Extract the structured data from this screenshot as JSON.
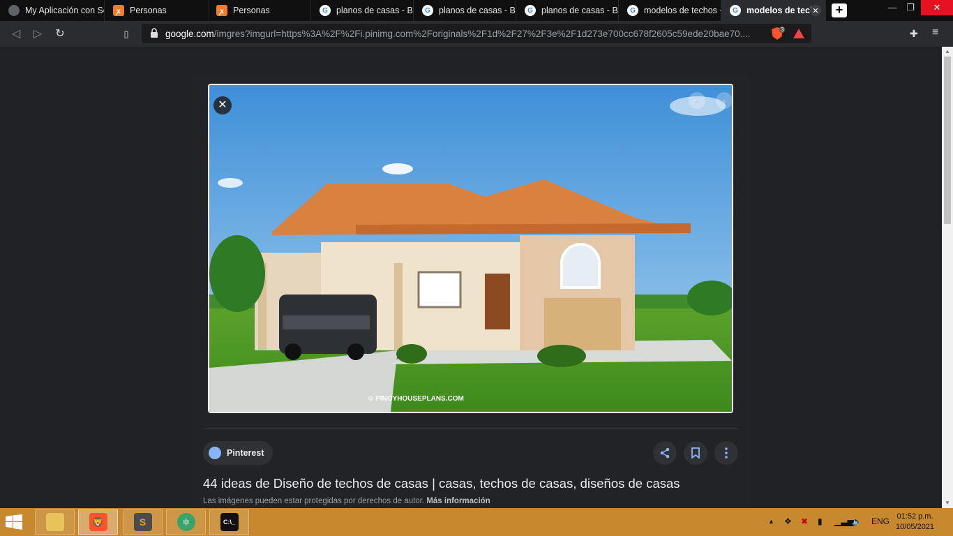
{
  "tabs": [
    {
      "title": "My Aplicación con Sc",
      "favicon": "globe-icon"
    },
    {
      "title": "Personas",
      "favicon": "xampp-icon"
    },
    {
      "title": "Personas",
      "favicon": "xampp-icon"
    },
    {
      "title": "planos de casas - Bú",
      "favicon": "google-icon"
    },
    {
      "title": "planos de casas - Bu",
      "favicon": "google-icon"
    },
    {
      "title": "planos de casas - Bu",
      "favicon": "google-icon"
    },
    {
      "title": "modelos de techos -",
      "favicon": "google-icon"
    },
    {
      "title": "modelos de tech",
      "favicon": "google-icon",
      "active": true
    }
  ],
  "new_tab_label": "+",
  "window": {
    "minimize": "—",
    "restore": "❐",
    "close": "✕"
  },
  "toolbar": {
    "url_host": "google.com",
    "url_path": "/imgres?imgurl=https%3A%2F%2Fi.pinimg.com%2Foriginals%2F1d%2F27%2F3e%2F1d273e700cc678f2605c59ede20bae70....",
    "shield_count": "3"
  },
  "viewer": {
    "image_watermark": "© PINOYHOUSEPLANS.COM",
    "source": "Pinterest",
    "title": "44 ideas de Diseño de techos de casas | casas, techos de casas, diseños de casas",
    "copyright_text": "Las imágenes pueden estar protegidas por derechos de autor.",
    "more_info": "Más información"
  },
  "taskbar": {
    "language": "ENG",
    "time": "01:52 p.m.",
    "date": "10/05/2021"
  },
  "colors": {
    "accent": "#8ab4f8",
    "taskbar": "#c8882e",
    "background": "#202124"
  }
}
